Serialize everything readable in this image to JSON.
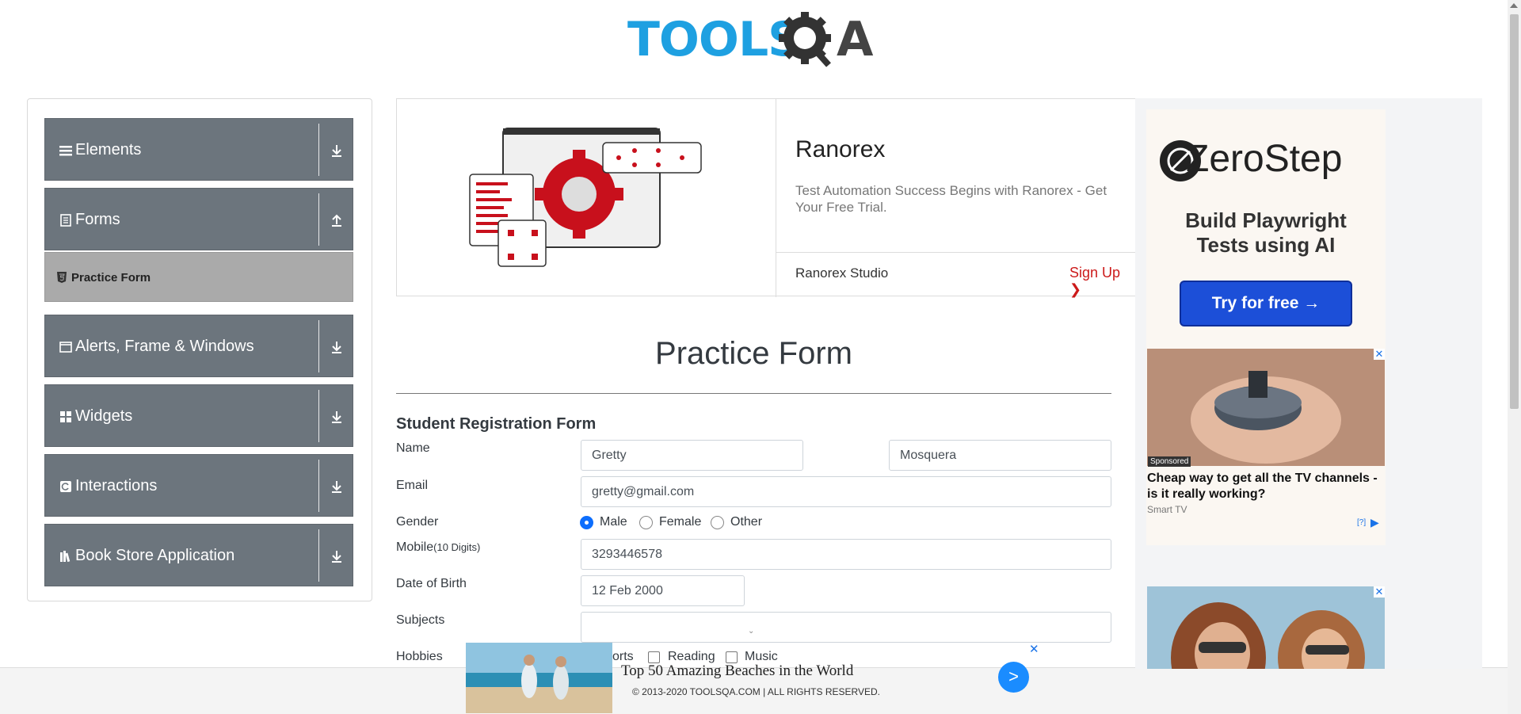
{
  "logo": {
    "part1": "TOOLS",
    "part2": "A"
  },
  "nav": {
    "groups": [
      {
        "label": "Elements",
        "icon": "hamburger-icon"
      },
      {
        "label": "Forms",
        "icon": "document-icon",
        "expanded": true,
        "subitems": [
          {
            "label": "Practice Form",
            "icon": "html5-icon"
          }
        ]
      },
      {
        "label": "Alerts, Frame & Windows",
        "icon": "window-icon"
      },
      {
        "label": "Widgets",
        "icon": "grid-icon"
      },
      {
        "label": "Interactions",
        "icon": "refresh-icon"
      },
      {
        "label": "Book Store Application",
        "icon": "books-icon"
      }
    ]
  },
  "topad": {
    "title": "Ranorex",
    "description": "Test Automation Success Begins with Ranorex - Get Your Free Trial.",
    "product": "Ranorex Studio",
    "cta": "Sign Up"
  },
  "form": {
    "title": "Practice Form",
    "subtitle": "Student Registration Form",
    "name_label": "Name",
    "first_name": "Gretty",
    "last_name": "Mosquera",
    "email_label": "Email",
    "email": "gretty@gmail.com",
    "gender_label": "Gender",
    "gender_options": [
      "Male",
      "Female",
      "Other"
    ],
    "gender_selected": "Male",
    "mobile_label": "Mobile",
    "mobile_hint": "(10 Digits)",
    "mobile": "3293446578",
    "dob_label": "Date of Birth",
    "dob": "12 Feb 2000",
    "subjects_label": "Subjects",
    "hobbies_label": "Hobbies",
    "hobby_sports_partial": "orts",
    "hobbies": [
      "Reading",
      "Music"
    ]
  },
  "rightad": {
    "brand": "ZeroStep",
    "headline_line1": "Build Playwright",
    "headline_line2": "Tests using AI",
    "cta": "Try for free →",
    "sponsored_badge": "Sponsored",
    "sponsored_title": "Cheap way to get all the TV channels - is it really working?",
    "sponsored_source": "Smart TV",
    "adchoices": "[?]"
  },
  "bottomad": {
    "title": "Top 50 Amazing Beaches in the World",
    "cta_symbol": ">",
    "close_symbol": "✕"
  },
  "footer": {
    "text": "© 2013-2020 TOOLSQA.COM | ALL RIGHTS RESERVED."
  },
  "colors": {
    "logo_blue": "#1ea0e1",
    "logo_dark": "#444444",
    "nav_bg": "#6c757d",
    "sub_bg": "#aaaaaa",
    "accent_red": "#cc1a1a",
    "zerostep_blue": "#1c4fd8"
  }
}
